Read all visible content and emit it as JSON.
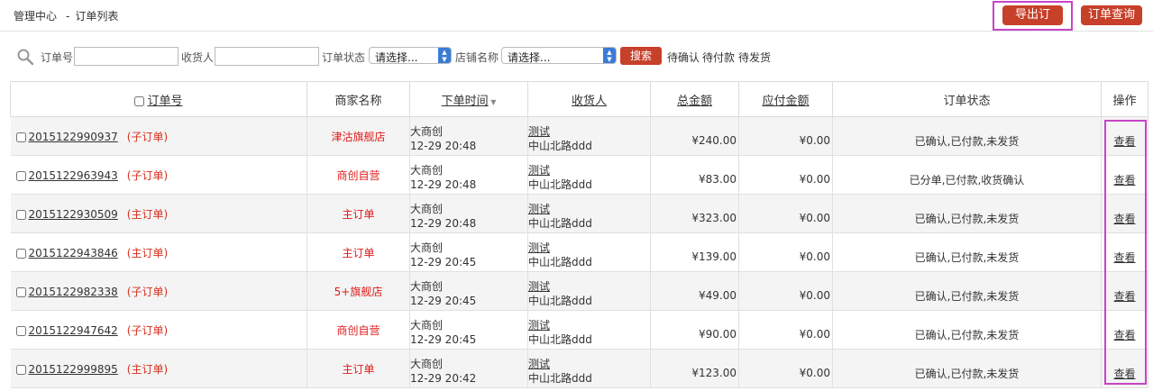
{
  "breadcrumb": {
    "root": "管理中心",
    "sep": "-",
    "current": "订单列表"
  },
  "header_buttons": {
    "export": "导出订单",
    "query": "订单查询"
  },
  "filters": {
    "order_no_label": "订单号",
    "order_no_value": "",
    "receiver_label": "收货人",
    "receiver_value": "",
    "status_label": "订单状态",
    "status_selected": "请选择...",
    "shop_label": "店铺名称",
    "shop_selected": "请选择...",
    "search_button": "搜索",
    "quick_links": [
      "待确认",
      "待付款",
      "待发货"
    ]
  },
  "table": {
    "headers": {
      "order_no": "订单号",
      "merchant": "商家名称",
      "order_time": "下单时间",
      "receiver": "收货人",
      "total": "总金额",
      "payable": "应付金额",
      "status": "订单状态",
      "action": "操作"
    },
    "rows": [
      {
        "order_no": "2015122990937",
        "type": "(子订单)",
        "merchant": "津沽旗舰店",
        "user": "大商创",
        "time": "12-29 20:48",
        "receiver_name": "测试",
        "receiver_addr": "中山北路ddd",
        "total": "¥240.00",
        "payable": "¥0.00",
        "status": "已确认,已付款,未发货",
        "action": "查看"
      },
      {
        "order_no": "2015122963943",
        "type": "(子订单)",
        "merchant": "商创自营",
        "user": "大商创",
        "time": "12-29 20:48",
        "receiver_name": "测试",
        "receiver_addr": "中山北路ddd",
        "total": "¥83.00",
        "payable": "¥0.00",
        "status": "已分单,已付款,收货确认",
        "action": "查看"
      },
      {
        "order_no": "2015122930509",
        "type": "(主订单)",
        "merchant": "主订单",
        "user": "大商创",
        "time": "12-29 20:48",
        "receiver_name": "测试",
        "receiver_addr": "中山北路ddd",
        "total": "¥323.00",
        "payable": "¥0.00",
        "status": "已确认,已付款,未发货",
        "action": "查看"
      },
      {
        "order_no": "2015122943846",
        "type": "(主订单)",
        "merchant": "主订单",
        "user": "大商创",
        "time": "12-29 20:45",
        "receiver_name": "测试",
        "receiver_addr": "中山北路ddd",
        "total": "¥139.00",
        "payable": "¥0.00",
        "status": "已确认,已付款,未发货",
        "action": "查看"
      },
      {
        "order_no": "2015122982338",
        "type": "(子订单)",
        "merchant": "5+旗舰店",
        "user": "大商创",
        "time": "12-29 20:45",
        "receiver_name": "测试",
        "receiver_addr": "中山北路ddd",
        "total": "¥49.00",
        "payable": "¥0.00",
        "status": "已确认,已付款,未发货",
        "action": "查看"
      },
      {
        "order_no": "2015122947642",
        "type": "(子订单)",
        "merchant": "商创自营",
        "user": "大商创",
        "time": "12-29 20:45",
        "receiver_name": "测试",
        "receiver_addr": "中山北路ddd",
        "total": "¥90.00",
        "payable": "¥0.00",
        "status": "已确认,已付款,未发货",
        "action": "查看"
      },
      {
        "order_no": "2015122999895",
        "type": "(主订单)",
        "merchant": "主订单",
        "user": "大商创",
        "time": "12-29 20:42",
        "receiver_name": "测试",
        "receiver_addr": "中山北路ddd",
        "total": "¥123.00",
        "payable": "¥0.00",
        "status": "已确认,已付款,未发货",
        "action": "查看"
      }
    ]
  },
  "colors": {
    "accent_red": "#c7402a",
    "highlight": "#c844c8",
    "merchant_text": "#e01b1b"
  }
}
